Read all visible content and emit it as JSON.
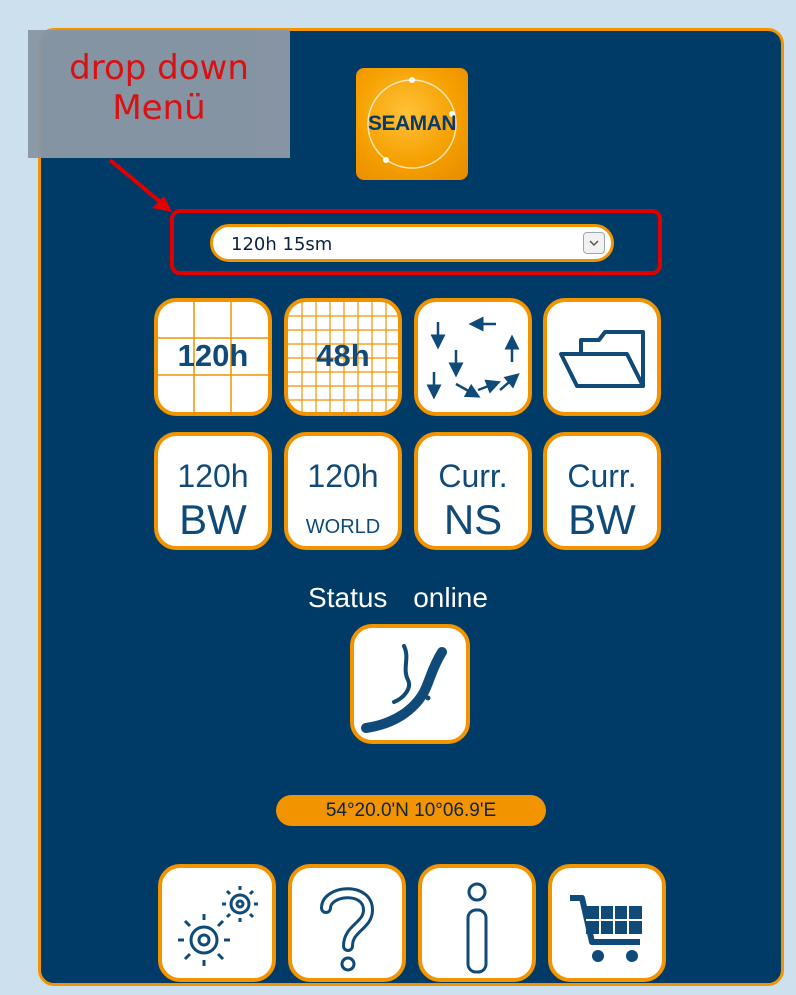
{
  "annotation": {
    "line1": "drop down",
    "line2": "Menü"
  },
  "logo": {
    "text": "SEAMAN"
  },
  "dropdown": {
    "value": "120h 15sm"
  },
  "tiles_row1": [
    {
      "label": "120h",
      "icon": "grid-120h-icon"
    },
    {
      "label": "48h",
      "icon": "grid-48h-icon"
    },
    {
      "icon": "arrows-icon"
    },
    {
      "icon": "folder-icon"
    }
  ],
  "tiles_row2": [
    {
      "top": "120h",
      "bottom": "BW"
    },
    {
      "top": "120h",
      "bottom": "WORLD"
    },
    {
      "top": "Curr.",
      "bottom": "NS"
    },
    {
      "top": "Curr.",
      "bottom": "BW"
    }
  ],
  "status": {
    "label": "Status",
    "value": "online"
  },
  "coords": "54°20.0'N 10°06.9'E",
  "footer_icons": [
    "settings-icon",
    "help-icon",
    "info-icon",
    "cart-icon"
  ],
  "colors": {
    "accent": "#f29400",
    "panel": "#003b67",
    "highlight": "#e00000",
    "text_blue": "#0f4a78"
  }
}
